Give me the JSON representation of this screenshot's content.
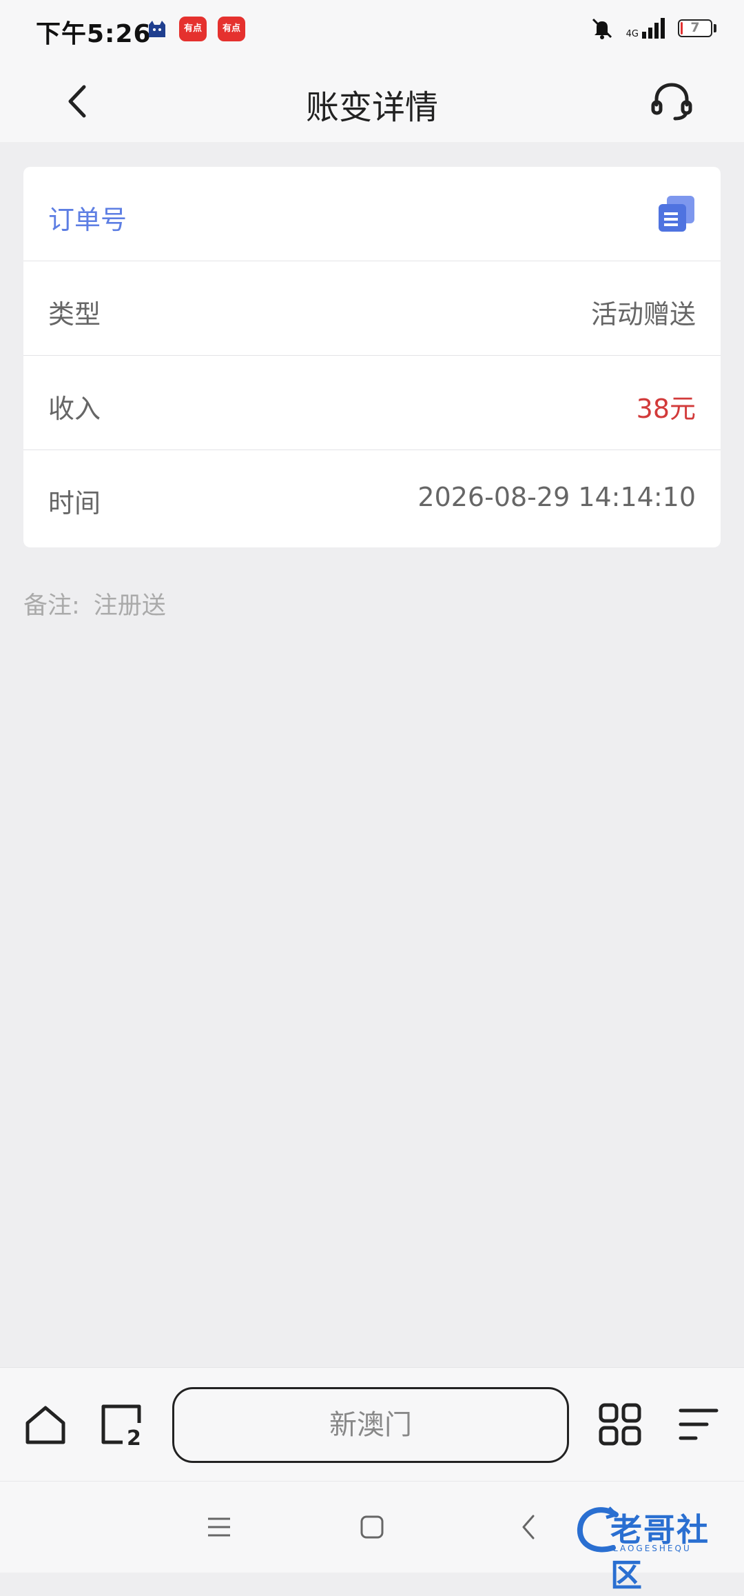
{
  "status_bar": {
    "time": "下午5:26",
    "notif_app_label": "有点",
    "network": "4G",
    "battery": "7",
    "battery_level": 0.07
  },
  "header": {
    "title": "账变详情"
  },
  "details": {
    "order_label": "订单号",
    "rows": [
      {
        "label": "类型",
        "value": "活动赠送"
      },
      {
        "label": "收入",
        "value": "38元"
      },
      {
        "label": "时间",
        "value": "2026-08-29 14:14:10"
      }
    ]
  },
  "remark": {
    "label": "备注:",
    "value": "注册送"
  },
  "browser_bar": {
    "address": "新澳门",
    "tab_count": "2"
  },
  "watermark": {
    "text": "老哥社区",
    "sub": "LAOGESHEQU"
  },
  "colors": {
    "accent": "#5d7ee3",
    "income": "#d23a3a",
    "background": "#eeeef0"
  },
  "icons": [
    "back-icon",
    "headset-icon",
    "copy-icon",
    "home-icon",
    "tabs-icon",
    "grid-icon",
    "menu-icon"
  ]
}
